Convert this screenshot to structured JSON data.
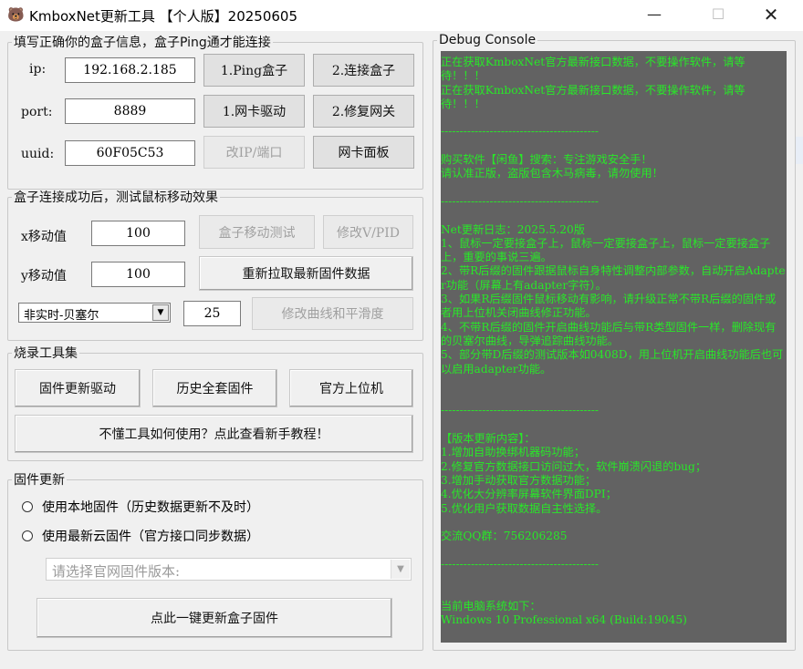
{
  "window": {
    "title": "KmboxNet更新工具 【个人版】20250605",
    "controls": {
      "minimize": "—",
      "maximize": "☐",
      "close": "✕"
    }
  },
  "box_info": {
    "legend": "填写正确你的盒子信息，盒子Ping通才能连接",
    "ip_label": "ip:",
    "ip_value": "192.168.2.185",
    "port_label": "port:",
    "port_value": "8889",
    "uuid_label": "uuid:",
    "uuid_value": "60F05C53",
    "btn_ping": "1.Ping盒子",
    "btn_connect": "2.连接盒子",
    "btn_nic_driver": "1.网卡驱动",
    "btn_fix_gateway": "2.修复网关",
    "btn_change_ip": "改IP/端口",
    "btn_nic_panel": "网卡面板"
  },
  "mouse_test": {
    "legend": "盒子连接成功后，测试鼠标移动效果",
    "x_label": "x移动值",
    "x_value": "100",
    "y_label": "y移动值",
    "y_value": "100",
    "btn_move_test": "盒子移动测试",
    "btn_modify_vpid": "修改V/PID",
    "btn_refetch_firmware": "重新拉取最新固件数据",
    "curve_select": "非实时-贝塞尔",
    "smooth_value": "25",
    "btn_modify_curve": "修改曲线和平滑度"
  },
  "flash_tools": {
    "legend": "烧录工具集",
    "btn_firmware_driver": "固件更新驱动",
    "btn_history_firmware": "历史全套固件",
    "btn_official_host": "官方上位机",
    "btn_tutorial": "不懂工具如何使用？点此查看新手教程！"
  },
  "firmware_update": {
    "legend": "固件更新",
    "radio_local": "使用本地固件（历史数据更新不及时）",
    "radio_cloud": "使用最新云固件（官方接口同步数据）",
    "version_placeholder": "请选择官网固件版本:",
    "btn_update": "点此一键更新盒子固件"
  },
  "console": {
    "legend": "Debug Console",
    "lines": [
      "正在获取KmboxNet官方最新接口数据，不要操作软件，请等待！！！",
      "正在获取KmboxNet官方最新接口数据，不要操作软件，请等待！！！",
      "",
      "------------------------------------------",
      "",
      "购买软件【闲鱼】搜索：专注游戏安全手！",
      "请认准正版，盗版包含木马病毒，请勿使用！",
      "",
      "------------------------------------------",
      "",
      "Net更新日志：2025.5.20版",
      "1、鼠标一定要接盒子上，鼠标一定要接盒子上，鼠标一定要接盒子上，重要的事说三遍。",
      "2、带R后缀的固件跟据鼠标自身特性调整内部参数，自动开启Adapter功能（屏幕上有adapter字符）。",
      "3、如果R后缀固件鼠标移动有影响，请升级正常不带R后缀的固件或者用上位机关闭曲线修正功能。",
      "4、不带R后缀的固件开启曲线功能后与带R类型固件一样，删除现有的贝塞尔曲线，导弹追踪曲线功能。",
      "5、部分带D后缀的测试版本如0408D，用上位机开启曲线功能后也可以启用adapter功能。",
      "",
      "",
      "------------------------------------------",
      "",
      "【版本更新内容】：",
      "1.增加自助换绑机器码功能；",
      "2.修复官方数据接口访问过大，软件崩溃闪退的bug；",
      "3.增加手动获取官方数据功能；",
      "4.优化大分辨率屏幕软件界面DPI；",
      "5.优化用户获取数据自主性选择。",
      "",
      "交流QQ群：756206285",
      "",
      "------------------------------------------",
      "",
      "",
      "当前电脑系统如下：",
      "Windows 10 Professional x64 (Build:19045)",
      "",
      "------------------------------------------"
    ]
  },
  "colors": {
    "console_bg": "#626262",
    "console_text": "#28e828",
    "window_bg": "#f0f0f0",
    "button_bg": "#e1e1e1"
  }
}
